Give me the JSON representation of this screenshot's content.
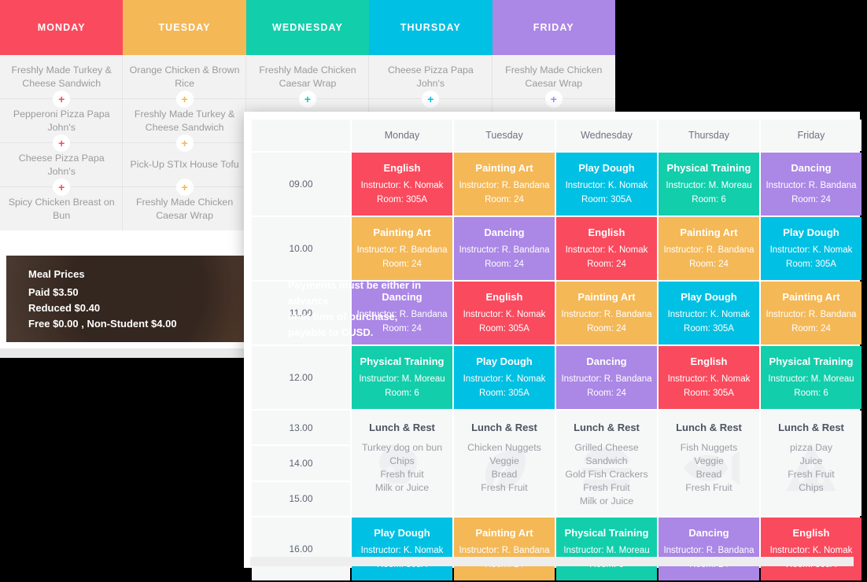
{
  "colors": {
    "red": "#fa4a5e",
    "orange": "#f4b857",
    "green": "#12ceab",
    "blue": "#00c0e3",
    "purple": "#ab87e6",
    "card_bg": "#ffffff",
    "cell_bg": "#f6f7f7",
    "menu_bg": "#f2f2f2",
    "page_bg": "#000000"
  },
  "menu_card": {
    "days": [
      {
        "label": "MONDAY",
        "color": "#fa4a5e"
      },
      {
        "label": "TUESDAY",
        "color": "#f4b857"
      },
      {
        "label": "WEDNESDAY",
        "color": "#12ceab"
      },
      {
        "label": "THURSDAY",
        "color": "#00c0e3"
      },
      {
        "label": "FRIDAY",
        "color": "#ab87e6"
      }
    ],
    "plus_icon": "+",
    "columns": [
      [
        "Freshly Made Turkey & Cheese Sandwich",
        "Pepperoni Pizza Papa John's",
        "Cheese Pizza Papa John's",
        "Spicy Chicken Breast on Bun"
      ],
      [
        "Orange Chicken & Brown Rice",
        "Freshly Made Turkey & Cheese Sandwich",
        "Pick-Up STIx House Tofu",
        "Freshly Made Chicken Caesar Wrap"
      ],
      [
        "Freshly Made Chicken Caesar Wrap",
        "",
        "",
        ""
      ],
      [
        "Cheese Pizza Papa John's",
        "",
        "",
        ""
      ],
      [
        "Freshly Made Chicken Caesar Wrap",
        "",
        "",
        ""
      ]
    ],
    "meal_prices": {
      "title": "Meal Prices",
      "line1": "Paid $3.50",
      "line2": "Reduced $0.40",
      "line3": "Free $0.00 , Non-Student $4.00",
      "note_line1": "Payments must be either in",
      "note_line2": "advance",
      "note_line3": "or at time of purchase,",
      "note_line4": "payable to CUSD."
    }
  },
  "schedule_card": {
    "corner_label": "",
    "day_headers": [
      "Monday",
      "Tuesday",
      "Wednesday",
      "Thursday",
      "Friday"
    ],
    "times": [
      "09.00",
      "10.00",
      "11.00",
      "12.00",
      "13.00",
      "14.00",
      "15.00",
      "16.00"
    ],
    "instructor_prefix": "Instructor:",
    "room_prefix": "Room:",
    "rows": [
      {
        "time": "09.00",
        "cells": [
          {
            "title": "English",
            "instructor": "Instructor: K. Nomak",
            "room": "Room: 305A",
            "color": "#fa4a5e"
          },
          {
            "title": "Painting Art",
            "instructor": "Instructor: R. Bandana",
            "room": "Room: 24",
            "color": "#f4b857"
          },
          {
            "title": "Play Dough",
            "instructor": "Instructor: K. Nomak",
            "room": "Room: 305A",
            "color": "#00c0e3"
          },
          {
            "title": "Physical Training",
            "instructor": "Instructor: M. Moreau",
            "room": "Room: 6",
            "color": "#12ceab"
          },
          {
            "title": "Dancing",
            "instructor": "Instructor: R. Bandana",
            "room": "Room: 24",
            "color": "#ab87e6"
          }
        ]
      },
      {
        "time": "10.00",
        "cells": [
          {
            "title": "Painting Art",
            "instructor": "Instructor: R. Bandana",
            "room": "Room: 24",
            "color": "#f4b857"
          },
          {
            "title": "Dancing",
            "instructor": "Instructor: R. Bandana",
            "room": "Room: 24",
            "color": "#ab87e6"
          },
          {
            "title": "English",
            "instructor": "Instructor: K. Nomak",
            "room": "Room: 24",
            "color": "#fa4a5e"
          },
          {
            "title": "Painting Art",
            "instructor": "Instructor: R. Bandana",
            "room": "Room: 24",
            "color": "#f4b857"
          },
          {
            "title": "Play Dough",
            "instructor": "Instructor: K. Nomak",
            "room": "Room: 305A",
            "color": "#00c0e3"
          }
        ]
      },
      {
        "time": "11.00",
        "cells": [
          {
            "title": "Dancing",
            "instructor": "Instructor: R. Bandana",
            "room": "Room: 24",
            "color": "#ab87e6"
          },
          {
            "title": "English",
            "instructor": "Instructor: K. Nomak",
            "room": "Room: 305A",
            "color": "#fa4a5e"
          },
          {
            "title": "Painting Art",
            "instructor": "Instructor: R. Bandana",
            "room": "Room: 24",
            "color": "#f4b857"
          },
          {
            "title": "Play Dough",
            "instructor": "Instructor: K. Nomak",
            "room": "Room: 305A",
            "color": "#00c0e3"
          },
          {
            "title": "Painting Art",
            "instructor": "Instructor: R. Bandana",
            "room": "Room: 24",
            "color": "#f4b857"
          }
        ]
      },
      {
        "time": "12.00",
        "cells": [
          {
            "title": "Physical Training",
            "instructor": "Instructor: M. Moreau",
            "room": "Room: 6",
            "color": "#12ceab"
          },
          {
            "title": "Play Dough",
            "instructor": "Instructor: K. Nomak",
            "room": "Room: 305A",
            "color": "#00c0e3"
          },
          {
            "title": "Dancing",
            "instructor": "Instructor: R. Bandana",
            "room": "Room: 24",
            "color": "#ab87e6"
          },
          {
            "title": "English",
            "instructor": "Instructor: K. Nomak",
            "room": "Room: 305A",
            "color": "#fa4a5e"
          },
          {
            "title": "Physical Training",
            "instructor": "Instructor: M. Moreau",
            "room": "Room: 6",
            "color": "#12ceab"
          }
        ]
      },
      {
        "time": "16.00",
        "cells": [
          {
            "title": "Play Dough",
            "instructor": "Instructor: K. Nomak",
            "room": "Room: 305A",
            "color": "#00c0e3"
          },
          {
            "title": "Painting Art",
            "instructor": "Instructor: R. Bandana",
            "room": "Room: 24",
            "color": "#f4b857"
          },
          {
            "title": "Physical Training",
            "instructor": "Instructor: M. Moreau",
            "room": "Room: 6",
            "color": "#12ceab"
          },
          {
            "title": "Dancing",
            "instructor": "Instructor: R. Bandana",
            "room": "Room: 24",
            "color": "#ab87e6"
          },
          {
            "title": "English",
            "instructor": "Instructor: K. Nomak",
            "room": "Room: 305A",
            "color": "#fa4a5e"
          }
        ]
      }
    ],
    "lunch_block": {
      "times": [
        "13.00",
        "14.00",
        "15.00"
      ],
      "title": "Lunch & Rest",
      "columns": [
        {
          "watermark": "apple-icon",
          "items": [
            "Turkey dog on bun",
            "Chips",
            "Fresh fruit",
            "Milk or Juice"
          ]
        },
        {
          "watermark": "leaf-icon",
          "items": [
            "Chicken Nuggets",
            "Veggie",
            "Bread",
            "Fresh Fruit"
          ]
        },
        {
          "watermark": "burger-icon",
          "items": [
            "Grilled Cheese Sandwich",
            "Gold Fish Crackers",
            "Fresh Fruit",
            "Milk or Juice"
          ]
        },
        {
          "watermark": "fish-icon",
          "items": [
            "Fish Nuggets",
            "Veggie",
            "Bread",
            "Fresh Fruit"
          ]
        },
        {
          "watermark": "pizza-icon",
          "items": [
            "pizza Day",
            "Juice",
            "Fresh Fruit",
            "Chips"
          ]
        }
      ]
    }
  }
}
